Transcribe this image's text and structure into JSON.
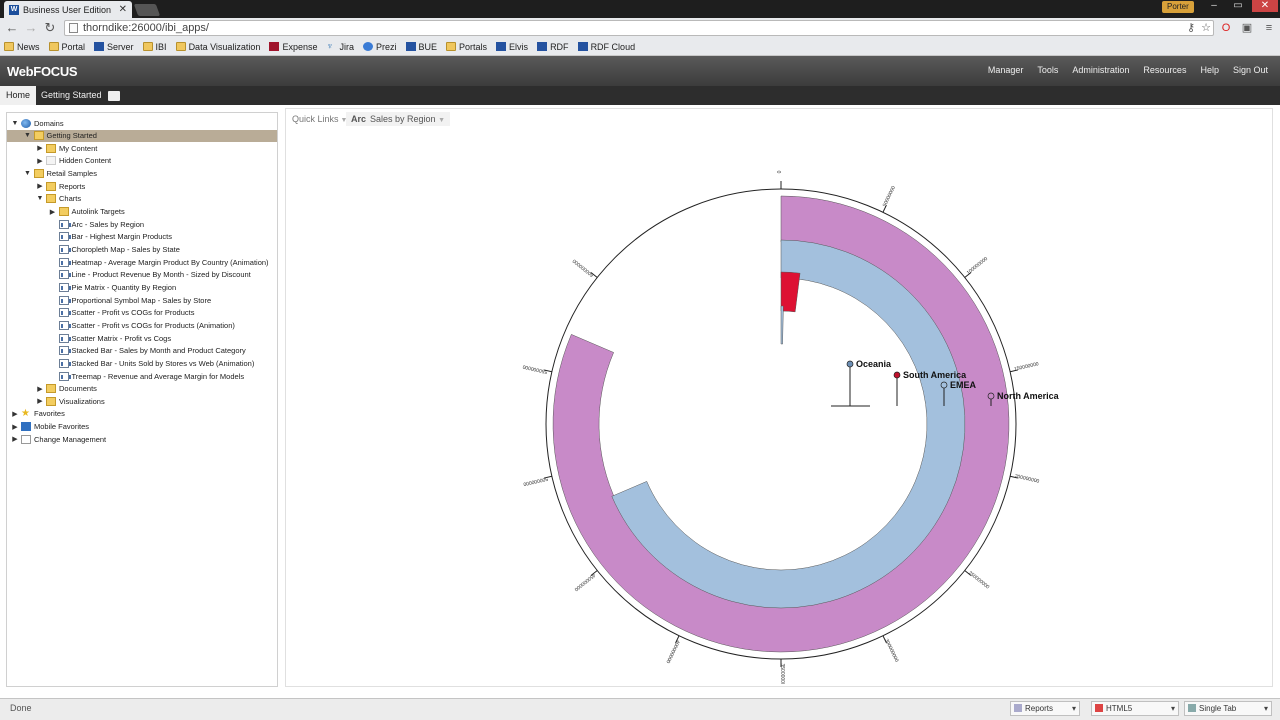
{
  "browser": {
    "tab_title": "Business User Edition",
    "tab_close": "✕",
    "url": "thorndike:26000/ibi_apps/",
    "user": "Porter",
    "bookmarks": [
      {
        "label": "News",
        "icon": "folder-icon"
      },
      {
        "label": "Portal",
        "icon": "folder-icon"
      },
      {
        "label": "Server",
        "icon": "webfocus-icon"
      },
      {
        "label": "IBI",
        "icon": "folder-icon"
      },
      {
        "label": "Data Visualization",
        "icon": "folder-icon"
      },
      {
        "label": "Expense",
        "icon": "expense-icon"
      },
      {
        "label": "Jira",
        "icon": "jira-icon"
      },
      {
        "label": "Prezi",
        "icon": "prezi-icon"
      },
      {
        "label": "BUE",
        "icon": "webfocus-icon"
      },
      {
        "label": "Portals",
        "icon": "folder-icon"
      },
      {
        "label": "Elvis",
        "icon": "webfocus-icon"
      },
      {
        "label": "RDF",
        "icon": "webfocus-icon"
      },
      {
        "label": "RDF Cloud",
        "icon": "webfocus-icon"
      }
    ]
  },
  "app": {
    "logo": "WebFOCUS",
    "menu": [
      "Manager",
      "Tools",
      "Administration",
      "Resources",
      "Help",
      "Sign Out"
    ],
    "tabs": {
      "home": "Home",
      "getting_started": "Getting Started"
    }
  },
  "tree": [
    {
      "label": "Domains",
      "depth": 0,
      "twisty": "▼",
      "icon": "globe",
      "selected": false
    },
    {
      "label": "Getting Started",
      "depth": 1,
      "twisty": "▼",
      "icon": "folder",
      "selected": true
    },
    {
      "label": "My Content",
      "depth": 2,
      "twisty": "▶",
      "icon": "folder",
      "selected": false
    },
    {
      "label": "Hidden Content",
      "depth": 2,
      "twisty": "▶",
      "icon": "blank",
      "selected": false
    },
    {
      "label": "Retail Samples",
      "depth": 1,
      "twisty": "▼",
      "icon": "folder",
      "selected": false
    },
    {
      "label": "Reports",
      "depth": 2,
      "twisty": "▶",
      "icon": "folder",
      "selected": false
    },
    {
      "label": "Charts",
      "depth": 2,
      "twisty": "▼",
      "icon": "folder",
      "selected": false
    },
    {
      "label": "Autolink Targets",
      "depth": 3,
      "twisty": "▶",
      "icon": "folder",
      "selected": false
    },
    {
      "label": "Arc - Sales by Region",
      "depth": 3,
      "twisty": "",
      "icon": "chart",
      "selected": false
    },
    {
      "label": "Bar - Highest Margin Products",
      "depth": 3,
      "twisty": "",
      "icon": "chart",
      "selected": false
    },
    {
      "label": "Choropleth Map - Sales by State",
      "depth": 3,
      "twisty": "",
      "icon": "chart",
      "selected": false
    },
    {
      "label": "Heatmap - Average Margin Product By Country (Animation)",
      "depth": 3,
      "twisty": "",
      "icon": "chart",
      "selected": false
    },
    {
      "label": "Line - Product Revenue By Month - Sized by Discount",
      "depth": 3,
      "twisty": "",
      "icon": "chart",
      "selected": false
    },
    {
      "label": "Pie Matrix - Quantity By Region",
      "depth": 3,
      "twisty": "",
      "icon": "chart",
      "selected": false
    },
    {
      "label": "Proportional Symbol Map - Sales by Store",
      "depth": 3,
      "twisty": "",
      "icon": "chart",
      "selected": false
    },
    {
      "label": "Scatter - Profit vs COGs for Products",
      "depth": 3,
      "twisty": "",
      "icon": "chart",
      "selected": false
    },
    {
      "label": "Scatter - Profit vs COGs for Products (Animation)",
      "depth": 3,
      "twisty": "",
      "icon": "chart",
      "selected": false
    },
    {
      "label": "Scatter Matrix - Profit vs Cogs",
      "depth": 3,
      "twisty": "",
      "icon": "chart",
      "selected": false
    },
    {
      "label": "Stacked Bar - Sales by Month and Product Category",
      "depth": 3,
      "twisty": "",
      "icon": "chart",
      "selected": false
    },
    {
      "label": "Stacked Bar - Units Sold by Stores vs Web (Animation)",
      "depth": 3,
      "twisty": "",
      "icon": "chart",
      "selected": false
    },
    {
      "label": "Treemap - Revenue and Average Margin for Models",
      "depth": 3,
      "twisty": "",
      "icon": "chart",
      "selected": false
    },
    {
      "label": "Documents",
      "depth": 2,
      "twisty": "▶",
      "icon": "folder",
      "selected": false
    },
    {
      "label": "Visualizations",
      "depth": 2,
      "twisty": "▶",
      "icon": "folder",
      "selected": false
    },
    {
      "label": "Favorites",
      "depth": 0,
      "twisty": "▶",
      "icon": "star",
      "selected": false
    },
    {
      "label": "Mobile Favorites",
      "depth": 0,
      "twisty": "▶",
      "icon": "mobile",
      "selected": false
    },
    {
      "label": "Change Management",
      "depth": 0,
      "twisty": "▶",
      "icon": "change",
      "selected": false
    }
  ],
  "content": {
    "quick_links": "Quick Links",
    "tab_type": "Arc",
    "tab_title": "Sales by Region"
  },
  "chart_data": {
    "type": "arc",
    "series": [
      {
        "name": "North America",
        "value": 570000000,
        "color": "#c88ac8"
      },
      {
        "name": "EMEA",
        "value": 480000000,
        "color": "#a3c0dd"
      },
      {
        "name": "South America",
        "value": 14000000,
        "color": "#dd1133"
      },
      {
        "name": "Oceania",
        "value": 1500000,
        "color": "#a3c0dd"
      }
    ],
    "legend_colors": {
      "Oceania": "#6d8fb5",
      "South America": "#c0102c",
      "EMEA": "#a3c0dd",
      "North America": "#c88ac8"
    },
    "scale_max": 700000000,
    "ticks": [
      "0",
      "50000000",
      "100000000",
      "150000000",
      "200000000",
      "250000000",
      "300000000",
      "350000000",
      "400000000",
      "450000000",
      "500000000",
      "550000000",
      "600000000"
    ]
  },
  "status": {
    "text": "Done",
    "reports": "Reports",
    "format": "HTML5",
    "output": "Single Tab"
  }
}
